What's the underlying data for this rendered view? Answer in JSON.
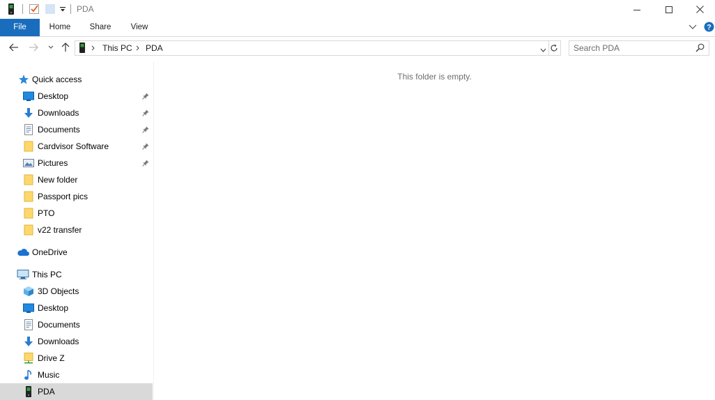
{
  "window": {
    "title": "PDA"
  },
  "ribbon": {
    "tabs": [
      "File",
      "Home",
      "Share",
      "View"
    ]
  },
  "address": {
    "segments": [
      "This PC",
      "PDA"
    ]
  },
  "search": {
    "placeholder": "Search PDA"
  },
  "content": {
    "empty_message": "This folder is empty."
  },
  "nav": {
    "quick_access": "Quick access",
    "quick_items": [
      {
        "label": "Desktop",
        "icon": "desktop-icon",
        "pinned": true
      },
      {
        "label": "Downloads",
        "icon": "downloads-icon",
        "pinned": true
      },
      {
        "label": "Documents",
        "icon": "documents-icon",
        "pinned": true
      },
      {
        "label": "Cardvisor Software",
        "icon": "folder-icon",
        "pinned": true
      },
      {
        "label": "Pictures",
        "icon": "pictures-icon",
        "pinned": true
      },
      {
        "label": "New folder",
        "icon": "folder-icon",
        "pinned": false
      },
      {
        "label": "Passport pics",
        "icon": "folder-icon",
        "pinned": false
      },
      {
        "label": "PTO",
        "icon": "folder-icon",
        "pinned": false
      },
      {
        "label": "v22 transfer",
        "icon": "folder-icon",
        "pinned": false
      }
    ],
    "onedrive": "OneDrive",
    "this_pc": "This PC",
    "pc_items": [
      {
        "label": "3D Objects",
        "icon": "3d-objects-icon"
      },
      {
        "label": "Desktop",
        "icon": "desktop-icon"
      },
      {
        "label": "Documents",
        "icon": "documents-icon"
      },
      {
        "label": "Downloads",
        "icon": "downloads-icon"
      },
      {
        "label": "Drive Z",
        "icon": "network-drive-icon"
      },
      {
        "label": "Music",
        "icon": "music-icon"
      },
      {
        "label": "PDA",
        "icon": "device-icon",
        "selected": true
      }
    ]
  },
  "colors": {
    "accent": "#1a6dbd",
    "selected_row": "#d9d9d9",
    "folder": "#ffd86b"
  }
}
